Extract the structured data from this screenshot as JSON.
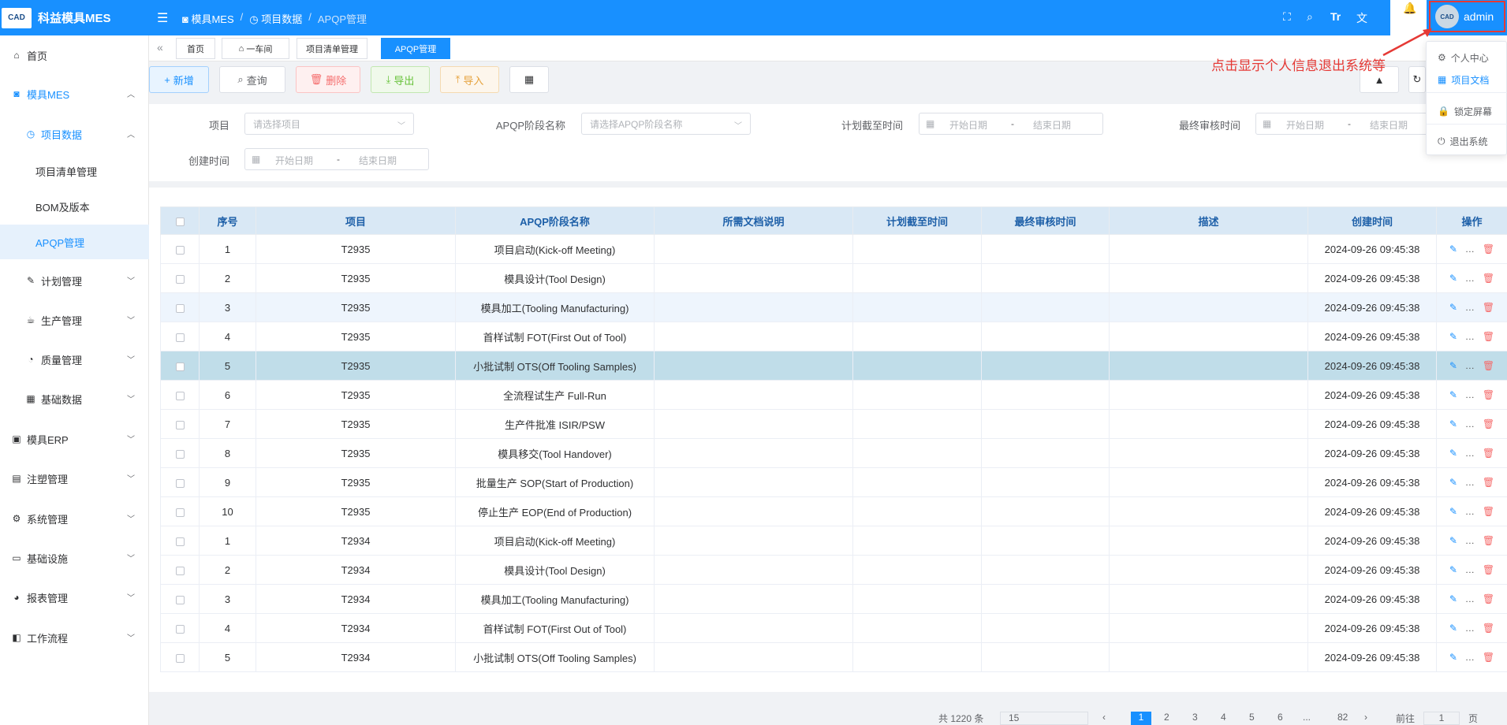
{
  "app": {
    "logo_text": "CAD",
    "title": "科益模具MES"
  },
  "sidebar": {
    "items": [
      {
        "label": "首页",
        "icon": "home-icon"
      },
      {
        "label": "模具MES",
        "icon": "camera-icon"
      },
      {
        "label": "项目数据",
        "icon": "alarm-clock-icon"
      },
      {
        "label": "项目清单管理"
      },
      {
        "label": "BOM及版本"
      },
      {
        "label": "APQP管理"
      },
      {
        "label": "计划管理",
        "icon": "edit-icon"
      },
      {
        "label": "生产管理",
        "icon": "cup-icon"
      },
      {
        "label": "质量管理",
        "icon": "stopwatch-icon"
      },
      {
        "label": "基础数据",
        "icon": "calendar-icon"
      },
      {
        "label": "模具ERP",
        "icon": "briefcase-icon"
      },
      {
        "label": "注塑管理",
        "icon": "box-icon"
      },
      {
        "label": "系统管理",
        "icon": "gear-icon"
      },
      {
        "label": "基础设施",
        "icon": "monitor-icon"
      },
      {
        "label": "报表管理",
        "icon": "pie-chart-icon"
      },
      {
        "label": "工作流程",
        "icon": "flow-icon"
      }
    ]
  },
  "topbar": {
    "breadcrumbs": [
      "模具MES",
      "项目数据",
      "APQP管理"
    ],
    "username": "admin",
    "avatar_text": "CAD"
  },
  "tags": [
    "首页",
    "一车间",
    "项目清单管理",
    "APQP管理"
  ],
  "toolbar": {
    "add": "新增",
    "query": "查询",
    "delete": "删除",
    "export": "导出",
    "import": "导入"
  },
  "filters": {
    "project_label": "项目",
    "project_placeholder": "请选择项目",
    "stage_label": "APQP阶段名称",
    "stage_placeholder": "请选择APQP阶段名称",
    "deadline_label": "计划截至时间",
    "audit_label": "最终审核时间",
    "created_label": "创建时间",
    "start_date": "开始日期",
    "end_date": "结束日期",
    "range_sep": "-"
  },
  "table": {
    "columns": [
      "序号",
      "项目",
      "APQP阶段名称",
      "所需文档说明",
      "计划截至时间",
      "最终审核时间",
      "描述",
      "创建时间",
      "操作"
    ],
    "rows": [
      {
        "no": "1",
        "project": "T2935",
        "stage": "项目启动(Kick-off Meeting)",
        "created": "2024-09-26 09:45:38"
      },
      {
        "no": "2",
        "project": "T2935",
        "stage": "模具设计(Tool Design)",
        "created": "2024-09-26 09:45:38"
      },
      {
        "no": "3",
        "project": "T2935",
        "stage": "模具加工(Tooling Manufacturing)",
        "created": "2024-09-26 09:45:38"
      },
      {
        "no": "4",
        "project": "T2935",
        "stage": "首样试制 FOT(First Out of Tool)",
        "created": "2024-09-26 09:45:38"
      },
      {
        "no": "5",
        "project": "T2935",
        "stage": "小批试制 OTS(Off Tooling Samples)",
        "created": "2024-09-26 09:45:38"
      },
      {
        "no": "6",
        "project": "T2935",
        "stage": "全流程试生产 Full-Run",
        "created": "2024-09-26 09:45:38"
      },
      {
        "no": "7",
        "project": "T2935",
        "stage": "生产件批准 ISIR/PSW",
        "created": "2024-09-26 09:45:38"
      },
      {
        "no": "8",
        "project": "T2935",
        "stage": "模具移交(Tool Handover)",
        "created": "2024-09-26 09:45:38"
      },
      {
        "no": "9",
        "project": "T2935",
        "stage": "批量生产 SOP(Start of Production)",
        "created": "2024-09-26 09:45:38"
      },
      {
        "no": "10",
        "project": "T2935",
        "stage": "停止生产 EOP(End of Production)",
        "created": "2024-09-26 09:45:38"
      },
      {
        "no": "1",
        "project": "T2934",
        "stage": "项目启动(Kick-off Meeting)",
        "created": "2024-09-26 09:45:38"
      },
      {
        "no": "2",
        "project": "T2934",
        "stage": "模具设计(Tool Design)",
        "created": "2024-09-26 09:45:38"
      },
      {
        "no": "3",
        "project": "T2934",
        "stage": "模具加工(Tooling Manufacturing)",
        "created": "2024-09-26 09:45:38"
      },
      {
        "no": "4",
        "project": "T2934",
        "stage": "首样试制 FOT(First Out of Tool)",
        "created": "2024-09-26 09:45:38"
      },
      {
        "no": "5",
        "project": "T2934",
        "stage": "小批试制 OTS(Off Tooling Samples)",
        "created": "2024-09-26 09:45:38"
      }
    ]
  },
  "dropdown": {
    "items": [
      "个人中心",
      "项目文档",
      "锁定屏幕",
      "退出系统"
    ]
  },
  "annotation": "点击显示个人信息退出系统等",
  "pager": {
    "total": "共 1220 条",
    "page_size": "15",
    "pages": [
      "1",
      "2",
      "3",
      "4",
      "5",
      "6",
      "...",
      "82"
    ],
    "goto": "前往",
    "goto_value": "1",
    "page_unit": "页"
  },
  "colors": {
    "primary": "#1890ff",
    "danger": "#f56c6c",
    "success": "#67c23a",
    "warning": "#e6a23c",
    "annotation": "#e53935"
  }
}
